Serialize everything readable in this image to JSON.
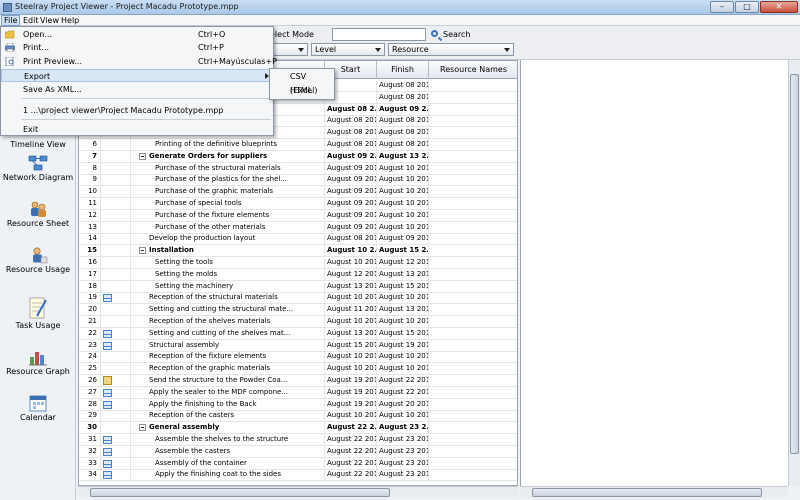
{
  "window": {
    "title": "Steelray Project Viewer - Project Macadu Prototype.mpp",
    "buttons": [
      "–",
      "□",
      "✕"
    ]
  },
  "menubar": [
    "File",
    "Edit",
    "View",
    "Help"
  ],
  "toolbar": {
    "mode_label": "elect Mode",
    "combo1": "",
    "combo2": "Level",
    "combo3": "Resource",
    "search_label": "Search",
    "search_value": ""
  },
  "file_menu": {
    "items": [
      {
        "label": "Open...",
        "shortcut": "Ctrl+O",
        "icon": "folder-icon"
      },
      {
        "label": "Print...",
        "shortcut": "Ctrl+P",
        "icon": "printer-icon"
      },
      {
        "label": "Print Preview...",
        "shortcut": "Ctrl+Mayúsculas+P",
        "icon": "preview-icon"
      },
      {
        "label": "Export",
        "shortcut": "",
        "icon": ""
      },
      {
        "label": "Save As XML...",
        "shortcut": "",
        "icon": ""
      }
    ],
    "recent": "1 ...\\project viewer\\Project Macadu Prototype.mpp",
    "exit": "Exit"
  },
  "export_submenu": [
    "CSV (Excel)",
    "HTML"
  ],
  "sidebar": [
    {
      "label": "Timeline View",
      "icon": "timeline-icon"
    },
    {
      "label": "Network Diagram",
      "icon": "network-diagram-icon"
    },
    {
      "label": "Resource Sheet",
      "icon": "resource-sheet-icon"
    },
    {
      "label": "Resource Usage",
      "icon": "resource-usage-icon"
    },
    {
      "label": "Task Usage",
      "icon": "task-usage-icon"
    },
    {
      "label": "Resource Graph",
      "icon": "resource-graph-icon"
    },
    {
      "label": "Calendar",
      "icon": "calendar-icon"
    }
  ],
  "grid": {
    "headers": {
      "start": "Start",
      "finish": "Finish",
      "resources": "Resource Names"
    },
    "rows": [
      {
        "id": "",
        "name": "",
        "start": "",
        "finish": "August 08 201...",
        "bold": false,
        "indent": 0,
        "ind": ""
      },
      {
        "id": "",
        "name": "",
        "start": "",
        "finish": "August 08 201...",
        "bold": false,
        "indent": 0,
        "ind": ""
      },
      {
        "id": "",
        "name": "",
        "start": "August 08 2...",
        "finish": "August 09 2...",
        "bold": true,
        "indent": 0,
        "ind": ""
      },
      {
        "id": "",
        "name": "",
        "start": "August 08 201...",
        "finish": "August 08 201...",
        "bold": false,
        "indent": 0,
        "ind": ""
      },
      {
        "id": "",
        "name": "",
        "start": "August 08 201...",
        "finish": "August 08 201...",
        "bold": false,
        "indent": 0,
        "ind": ""
      },
      {
        "id": "6",
        "name": "Printing of the definitive blueprints",
        "start": "August 08 201...",
        "finish": "August 08 201...",
        "bold": false,
        "indent": 2,
        "ind": ""
      },
      {
        "id": "7",
        "name": "Generate Orders for suppliers",
        "start": "August 09 2...",
        "finish": "August 13 2...",
        "bold": true,
        "indent": 1,
        "ind": ""
      },
      {
        "id": "8",
        "name": "Purchase of the structural materials",
        "start": "August 09 201...",
        "finish": "August 10 201...",
        "bold": false,
        "indent": 2,
        "ind": ""
      },
      {
        "id": "9",
        "name": "Purchase of the plastics for the shel...",
        "start": "August 09 201...",
        "finish": "August 10 201...",
        "bold": false,
        "indent": 2,
        "ind": ""
      },
      {
        "id": "10",
        "name": "Purchase of the graphic materials",
        "start": "August 09 201...",
        "finish": "August 10 201...",
        "bold": false,
        "indent": 2,
        "ind": ""
      },
      {
        "id": "11",
        "name": "Purchase of special tools",
        "start": "August 09 201...",
        "finish": "August 10 201...",
        "bold": false,
        "indent": 2,
        "ind": ""
      },
      {
        "id": "12",
        "name": "Purchase of the fixture elements",
        "start": "August 09 201...",
        "finish": "August 10 201...",
        "bold": false,
        "indent": 2,
        "ind": ""
      },
      {
        "id": "13",
        "name": "Purchase of the other materials",
        "start": "August 09 201...",
        "finish": "August 10 201...",
        "bold": false,
        "indent": 2,
        "ind": ""
      },
      {
        "id": "14",
        "name": "Develop the production layout",
        "start": "August 08 201...",
        "finish": "August 09 201...",
        "bold": false,
        "indent": 1,
        "ind": ""
      },
      {
        "id": "15",
        "name": "Installation",
        "start": "August 10 2...",
        "finish": "August 15 2...",
        "bold": true,
        "indent": 1,
        "ind": ""
      },
      {
        "id": "16",
        "name": "Setting the tools",
        "start": "August 10 201...",
        "finish": "August 12 201...",
        "bold": false,
        "indent": 2,
        "ind": ""
      },
      {
        "id": "17",
        "name": "Setting the molds",
        "start": "August 12 201...",
        "finish": "August 13 201...",
        "bold": false,
        "indent": 2,
        "ind": ""
      },
      {
        "id": "18",
        "name": "Setting the machinery",
        "start": "August 13 201...",
        "finish": "August 15 201...",
        "bold": false,
        "indent": 2,
        "ind": ""
      },
      {
        "id": "19",
        "name": "Reception of the structural materials",
        "start": "August 10 201...",
        "finish": "August 10 201...",
        "bold": false,
        "indent": 1,
        "ind": "grid"
      },
      {
        "id": "20",
        "name": "Setting and cutting the structural mate...",
        "start": "August 11 201...",
        "finish": "August 13 201...",
        "bold": false,
        "indent": 1,
        "ind": ""
      },
      {
        "id": "21",
        "name": "Reception of the shelves materials",
        "start": "August 10 201...",
        "finish": "August 10 201...",
        "bold": false,
        "indent": 1,
        "ind": ""
      },
      {
        "id": "22",
        "name": "Setting and cutting of the shelves mat...",
        "start": "August 13 201...",
        "finish": "August 15 201...",
        "bold": false,
        "indent": 1,
        "ind": "grid"
      },
      {
        "id": "23",
        "name": "Structural assembly",
        "start": "August 15 201...",
        "finish": "August 19 201...",
        "bold": false,
        "indent": 1,
        "ind": "grid"
      },
      {
        "id": "24",
        "name": "Reception of the fixture elements",
        "start": "August 10 201...",
        "finish": "August 10 201...",
        "bold": false,
        "indent": 1,
        "ind": ""
      },
      {
        "id": "25",
        "name": "Reception of the graphic materials",
        "start": "August 10 201...",
        "finish": "August 10 201...",
        "bold": false,
        "indent": 1,
        "ind": ""
      },
      {
        "id": "26",
        "name": "Send the structure to the Powder Coa...",
        "start": "August 19 201...",
        "finish": "August 22 201...",
        "bold": false,
        "indent": 1,
        "ind": "note"
      },
      {
        "id": "27",
        "name": "Apply the sealer to the MDF compone...",
        "start": "August 19 201...",
        "finish": "August 22 201...",
        "bold": false,
        "indent": 1,
        "ind": "grid"
      },
      {
        "id": "28",
        "name": "Apply the finishing to the Back",
        "start": "August 19 201...",
        "finish": "August 20 201...",
        "bold": false,
        "indent": 1,
        "ind": "grid"
      },
      {
        "id": "29",
        "name": "Reception of the casters",
        "start": "August 10 201...",
        "finish": "August 10 201...",
        "bold": false,
        "indent": 1,
        "ind": ""
      },
      {
        "id": "30",
        "name": "General assembly",
        "start": "August 22 2...",
        "finish": "August 23 2...",
        "bold": true,
        "indent": 1,
        "ind": ""
      },
      {
        "id": "31",
        "name": "Assemble the shelves to the structure",
        "start": "August 22 201...",
        "finish": "August 23 201...",
        "bold": false,
        "indent": 2,
        "ind": "grid"
      },
      {
        "id": "32",
        "name": "Assemble the casters",
        "start": "August 22 201...",
        "finish": "August 23 201...",
        "bold": false,
        "indent": 2,
        "ind": "grid"
      },
      {
        "id": "33",
        "name": "Assembly of the container",
        "start": "August 22 201...",
        "finish": "August 23 201...",
        "bold": false,
        "indent": 2,
        "ind": "grid"
      },
      {
        "id": "34",
        "name": "Apply the finishing coat to the sides",
        "start": "August 22 201...",
        "finish": "August 23 201...",
        "bold": false,
        "indent": 2,
        "ind": "grid"
      }
    ]
  }
}
